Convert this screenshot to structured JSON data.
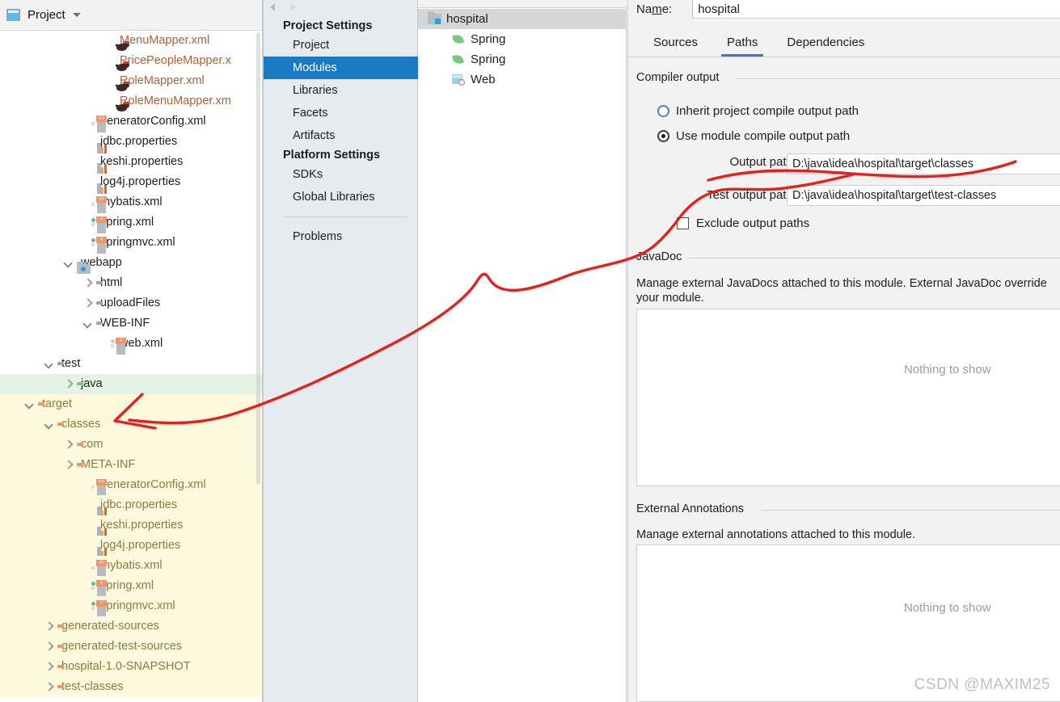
{
  "project_panel": {
    "header": {
      "title": "Project",
      "icon": "project-icon",
      "dropdown_icon": "chevron-down-icon"
    },
    "tree": [
      {
        "label": "MenuMapper.xml",
        "icon": "mybatis-xml-icon",
        "indent": 5,
        "arrow": "none",
        "style": "xml"
      },
      {
        "label": "PricePeopleMapper.x",
        "icon": "mybatis-xml-icon",
        "indent": 5,
        "arrow": "none",
        "style": "xml"
      },
      {
        "label": "RoleMapper.xml",
        "icon": "mybatis-xml-icon",
        "indent": 5,
        "arrow": "none",
        "style": "xml"
      },
      {
        "label": "RoleMenuMapper.xm",
        "icon": "mybatis-xml-icon",
        "indent": 5,
        "arrow": "none",
        "style": "xml"
      },
      {
        "label": "generatorConfig.xml",
        "icon": "xml-file-icon",
        "indent": 4,
        "arrow": "none",
        "style": "plain"
      },
      {
        "label": "jdbc.properties",
        "icon": "properties-file-icon",
        "indent": 4,
        "arrow": "none",
        "style": "plain"
      },
      {
        "label": "keshi.properties",
        "icon": "properties-file-icon",
        "indent": 4,
        "arrow": "none",
        "style": "plain"
      },
      {
        "label": "log4j.properties",
        "icon": "properties-file-icon",
        "indent": 4,
        "arrow": "none",
        "style": "plain"
      },
      {
        "label": "mybatis.xml",
        "icon": "xml-file-icon",
        "indent": 4,
        "arrow": "none",
        "style": "plain"
      },
      {
        "label": "spring.xml",
        "icon": "spring-xml-file-icon",
        "indent": 4,
        "arrow": "none",
        "style": "plain"
      },
      {
        "label": "springmvc.xml",
        "icon": "spring-xml-file-icon",
        "indent": 4,
        "arrow": "none",
        "style": "plain"
      },
      {
        "label": "webapp",
        "icon": "webapp-folder-icon",
        "indent": 3,
        "arrow": "down",
        "style": "plain"
      },
      {
        "label": "html",
        "icon": "folder-gray-icon",
        "indent": 4,
        "arrow": "right",
        "style": "plain"
      },
      {
        "label": "uploadFiles",
        "icon": "folder-gray-icon",
        "indent": 4,
        "arrow": "right",
        "style": "plain"
      },
      {
        "label": "WEB-INF",
        "icon": "folder-gray-icon",
        "indent": 4,
        "arrow": "down",
        "style": "plain"
      },
      {
        "label": "web.xml",
        "icon": "web-xml-file-icon",
        "indent": 5,
        "arrow": "none",
        "style": "plain"
      },
      {
        "label": "test",
        "icon": "folder-gray-icon",
        "indent": 2,
        "arrow": "down",
        "style": "plain"
      },
      {
        "label": "java",
        "icon": "folder-green-icon",
        "indent": 3,
        "arrow": "right",
        "style": "plain",
        "highlight": "green"
      },
      {
        "label": "target",
        "icon": "folder-orange-icon",
        "indent": 1,
        "arrow": "down",
        "style": "orange",
        "highlight": "yellow"
      },
      {
        "label": "classes",
        "icon": "folder-orange-icon",
        "indent": 2,
        "arrow": "down",
        "style": "orange",
        "highlight": "yellow"
      },
      {
        "label": "com",
        "icon": "folder-orange-icon",
        "indent": 3,
        "arrow": "right",
        "style": "orange",
        "highlight": "yellow"
      },
      {
        "label": "META-INF",
        "icon": "folder-orange-icon",
        "indent": 3,
        "arrow": "right",
        "style": "orange",
        "highlight": "yellow"
      },
      {
        "label": "generatorConfig.xml",
        "icon": "xml-file-icon",
        "indent": 4,
        "arrow": "none",
        "style": "orange",
        "highlight": "yellow"
      },
      {
        "label": "jdbc.properties",
        "icon": "properties-file-icon",
        "indent": 4,
        "arrow": "none",
        "style": "orange",
        "highlight": "yellow"
      },
      {
        "label": "keshi.properties",
        "icon": "properties-file-icon",
        "indent": 4,
        "arrow": "none",
        "style": "orange",
        "highlight": "yellow"
      },
      {
        "label": "log4j.properties",
        "icon": "properties-file-icon",
        "indent": 4,
        "arrow": "none",
        "style": "orange",
        "highlight": "yellow"
      },
      {
        "label": "mybatis.xml",
        "icon": "xml-file-icon",
        "indent": 4,
        "arrow": "none",
        "style": "orange",
        "highlight": "yellow"
      },
      {
        "label": "spring.xml",
        "icon": "spring-xml-file-icon",
        "indent": 4,
        "arrow": "none",
        "style": "orange",
        "highlight": "yellow"
      },
      {
        "label": "springmvc.xml",
        "icon": "spring-xml-file-icon",
        "indent": 4,
        "arrow": "none",
        "style": "orange",
        "highlight": "yellow"
      },
      {
        "label": "generated-sources",
        "icon": "folder-orange-icon",
        "indent": 2,
        "arrow": "right",
        "style": "orange",
        "highlight": "yellow"
      },
      {
        "label": "generated-test-sources",
        "icon": "folder-orange-icon",
        "indent": 2,
        "arrow": "right",
        "style": "orange",
        "highlight": "yellow"
      },
      {
        "label": "hospital-1.0-SNAPSHOT",
        "icon": "folder-orange-icon",
        "indent": 2,
        "arrow": "right",
        "style": "orange",
        "highlight": "yellow"
      },
      {
        "label": "test-classes",
        "icon": "folder-orange-icon",
        "indent": 2,
        "arrow": "right",
        "style": "orange",
        "highlight": "yellow"
      }
    ]
  },
  "settings": {
    "sidebar": {
      "sections": [
        {
          "header": "Project Settings",
          "items": [
            {
              "label": "Project",
              "selected": false
            },
            {
              "label": "Modules",
              "selected": true
            },
            {
              "label": "Libraries",
              "selected": false
            },
            {
              "label": "Facets",
              "selected": false
            },
            {
              "label": "Artifacts",
              "selected": false
            }
          ]
        },
        {
          "header": "Platform Settings",
          "items": [
            {
              "label": "SDKs",
              "selected": false
            },
            {
              "label": "Global Libraries",
              "selected": false
            }
          ]
        }
      ],
      "footer_items": [
        {
          "label": "Problems",
          "selected": false
        }
      ]
    },
    "module_list": [
      {
        "label": "hospital",
        "icon": "module-folder-icon",
        "indent": 0,
        "arrow": "down",
        "selected": true
      },
      {
        "label": "Spring",
        "icon": "spring-leaf-icon",
        "indent": 1,
        "arrow": "none",
        "selected": false
      },
      {
        "label": "Spring",
        "icon": "spring-leaf-icon",
        "indent": 1,
        "arrow": "none",
        "selected": false
      },
      {
        "label": "Web",
        "icon": "web-facet-icon",
        "indent": 1,
        "arrow": "none",
        "selected": false
      }
    ],
    "config": {
      "name_label": "Name:",
      "name_value": "hospital",
      "tabs": [
        {
          "label": "Sources",
          "active": false
        },
        {
          "label": "Paths",
          "active": true
        },
        {
          "label": "Dependencies",
          "active": false
        }
      ],
      "compiler_output": {
        "group_title": "Compiler output",
        "radio_inherit": "Inherit project compile output path",
        "radio_module": "Use module compile output path",
        "selected_radio": "Use module compile output path",
        "output_path_label": "Output path:",
        "output_path_value": "D:\\java\\idea\\hospital\\target\\classes",
        "test_output_path_label": "Test output path:",
        "test_output_path_value": "D:\\java\\idea\\hospital\\target\\test-classes",
        "exclude_checkbox_label": "Exclude output paths",
        "exclude_checked": false
      },
      "javadoc": {
        "group_title": "JavaDoc",
        "description": "Manage external JavaDocs attached to this module. External JavaDoc override",
        "description_line2": "your module.",
        "empty_text": "Nothing to show"
      },
      "external_annotations": {
        "group_title": "External Annotations",
        "description": "Manage external annotations attached to this module.",
        "empty_text": "Nothing to show"
      }
    }
  },
  "watermark": "CSDN @MAXIM25",
  "colors": {
    "accent_blue": "#1a7ac4",
    "tab_underline": "#3a7dc4",
    "annotation_red": "#e8201c",
    "folder_orange": "#f0976a",
    "folder_green": "#79c97f",
    "folder_gray": "#9aa7b0",
    "highlight_green": "#e4f3e3",
    "highlight_yellow": "#fdf9dd"
  }
}
